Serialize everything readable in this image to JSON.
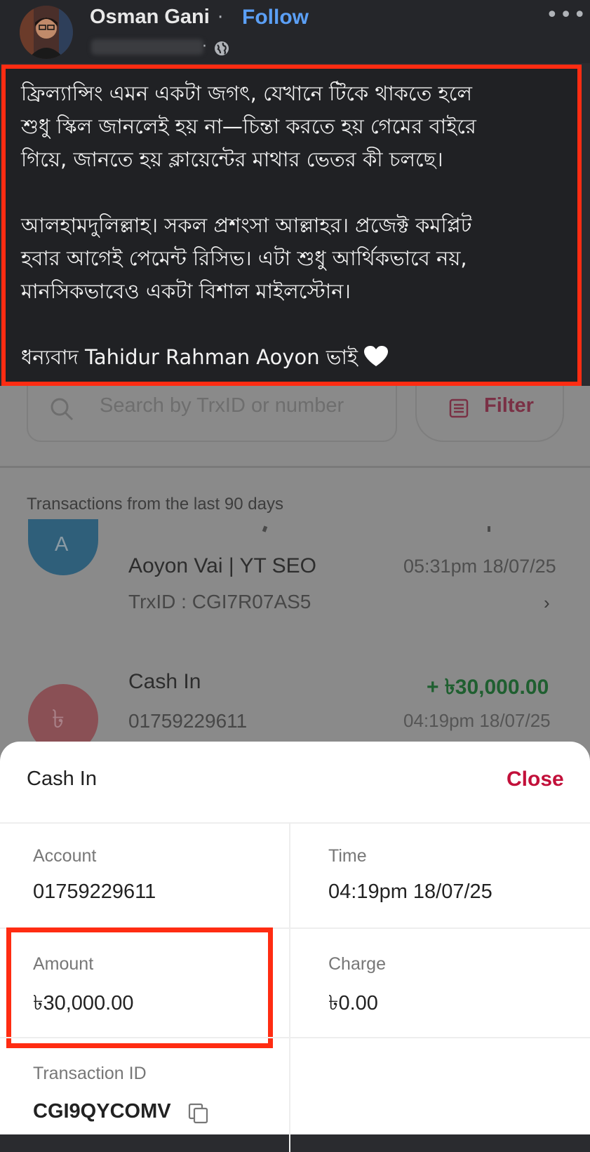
{
  "post": {
    "author": "Osman Gani",
    "separator": "·",
    "follow_label": "Follow",
    "more_label": "•••",
    "paragraphs": [
      [
        "ফ্রিল্যান্সিং এমন একটা জগৎ, যেখানে টিকে থাকতে হলে",
        "শুধু স্কিল জানলেই হয় না—চিন্তা করতে হয় গেমের বাইরে",
        "গিয়ে, জানতে হয় ক্লায়েন্টের মাথার ভেতর কী চলছে।"
      ],
      [
        "আলহামদুলিল্লাহ। সকল প্রশংসা আল্লাহর। প্রজেক্ট কমপ্লিট",
        "হবার আগেই পেমেন্ট রিসিভ। এটা শুধু আর্থিকভাবে নয়,",
        "মানসিকভাবেও একটা বিশাল মাইলস্টোন।"
      ]
    ],
    "thanks": "ধন্যবাদ Tahidur Rahman Aoyon ভাই",
    "heart_color": "#ffffff",
    "highlight_color": "#ff2c12"
  },
  "app": {
    "search_placeholder": "Search by TrxID or number",
    "filter_label": "Filter",
    "section_title": "Transactions from the last 90 days",
    "transactions": [
      {
        "avatar": "A",
        "name": "Aoyon Vai | YT SEO",
        "time": "05:31pm 18/07/25",
        "detail": "TrxID : CGI7R07AS5",
        "chevron": "›"
      },
      {
        "avatar": "৳",
        "name": "Cash In",
        "amount": "+ ৳30,000.00",
        "detail": "01759229611",
        "time": "04:19pm 18/07/25"
      }
    ]
  },
  "sheet": {
    "title": "Cash In",
    "close_label": "Close",
    "account_label": "Account",
    "account_value": "01759229611",
    "time_label": "Time",
    "time_value": "04:19pm 18/07/25",
    "amount_label": "Amount",
    "amount_value": "৳30,000.00",
    "charge_label": "Charge",
    "charge_value": "৳0.00",
    "trx_label": "Transaction ID",
    "trx_value": "CGI9QYCOMV",
    "accent_color": "#c2103a"
  }
}
